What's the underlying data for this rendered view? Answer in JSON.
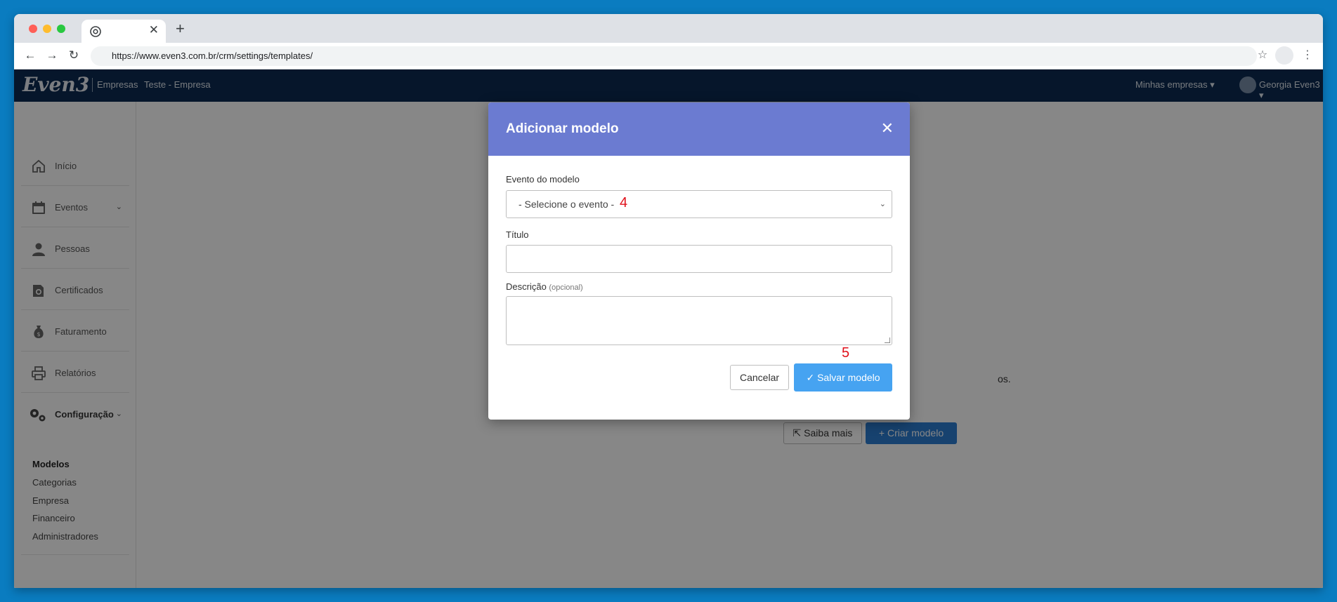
{
  "browser": {
    "url": "https://www.even3.com.br/crm/settings/templates/",
    "new_tab_label": "+",
    "tab_close": "✕"
  },
  "header": {
    "logo": "Even3",
    "brand_sub": "Empresas",
    "company": "Teste - Empresa",
    "my_companies": "Minhas empresas ▾",
    "user": "Georgia Even3 ▾"
  },
  "sidebar": {
    "items": [
      {
        "label": "Início",
        "icon": "home-icon"
      },
      {
        "label": "Eventos",
        "icon": "calendar-icon"
      },
      {
        "label": "Pessoas",
        "icon": "person-icon"
      },
      {
        "label": "Certificados",
        "icon": "certificate-icon"
      },
      {
        "label": "Faturamento",
        "icon": "money-bag-icon"
      },
      {
        "label": "Relatórios",
        "icon": "printer-icon"
      },
      {
        "label": "Configuração",
        "icon": "gears-icon"
      }
    ],
    "sub_items": [
      "Modelos",
      "Categorias",
      "Empresa",
      "Financeiro",
      "Administradores"
    ]
  },
  "content": {
    "saiba_mais": "Saiba mais",
    "criar_modelo": "Criar modelo",
    "partial_text": "os."
  },
  "modal": {
    "title": "Adicionar modelo",
    "close": "✕",
    "event_label": "Evento do modelo",
    "event_select_value": "- Selecione o evento -",
    "title_label": "Título",
    "title_value": "",
    "description_label": "Descrição",
    "description_optional": "(opcional)",
    "description_value": "",
    "cancel_label": "Cancelar",
    "save_label": "Salvar modelo",
    "annotation_4": "4",
    "annotation_5": "5"
  },
  "colors": {
    "desktop": "#0a7cc0",
    "app_header": "#0d2a52",
    "modal_header": "#6b7bd1",
    "primary_button": "#2d7dd2",
    "save_button": "#46a3f1",
    "annotation": "#e0111b"
  }
}
